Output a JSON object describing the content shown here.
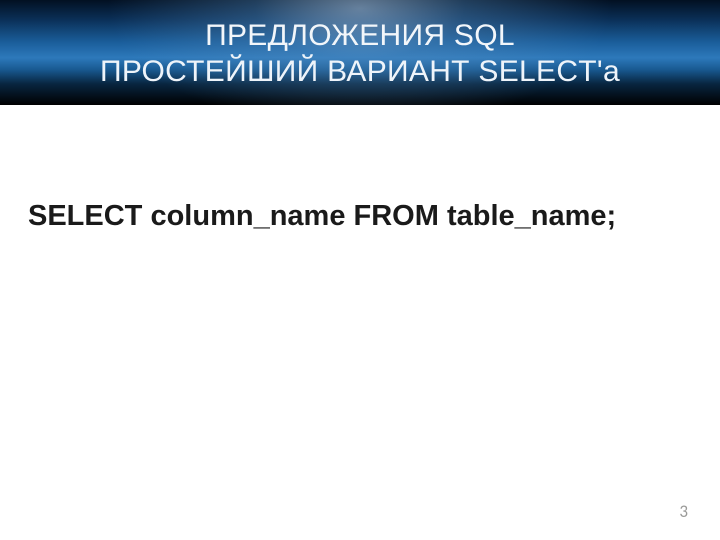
{
  "header": {
    "line1": "ПРЕДЛОЖЕНИЯ SQL",
    "line2": "ПРОСТЕЙШИЙ ВАРИАНТ SELECT'а"
  },
  "content": {
    "code": "SELECT column_name FROM table_name;"
  },
  "footer": {
    "page_number": "3"
  }
}
